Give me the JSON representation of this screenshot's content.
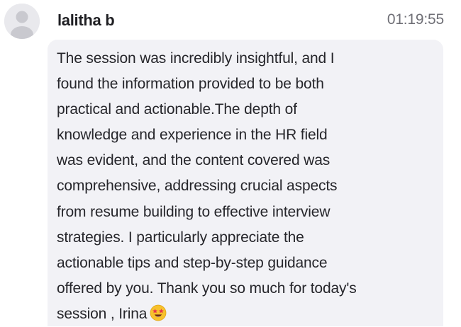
{
  "message": {
    "author": "lalitha b",
    "timestamp": "01:19:55",
    "avatar_icon": "user-silhouette-icon",
    "lines": [
      "The session was incredibly insightful, and I",
      "found the information provided to be both",
      "practical and actionable.The depth of",
      "knowledge and experience in the HR field",
      "was evident, and the content covered was",
      "comprehensive, addressing crucial aspects",
      "from resume building to effective interview",
      "strategies. I particularly appreciate the",
      "actionable tips and step-by-step guidance",
      "offered by you. Thank you so much for today's",
      "session , Irina"
    ],
    "emoji": "star-struck-emoji",
    "colors": {
      "bubble_background": "#f2f2f6",
      "avatar_background": "#e9e9ed",
      "author_text": "#1f1f23",
      "timestamp_text": "#6f6f76",
      "body_text": "#26262b"
    }
  }
}
